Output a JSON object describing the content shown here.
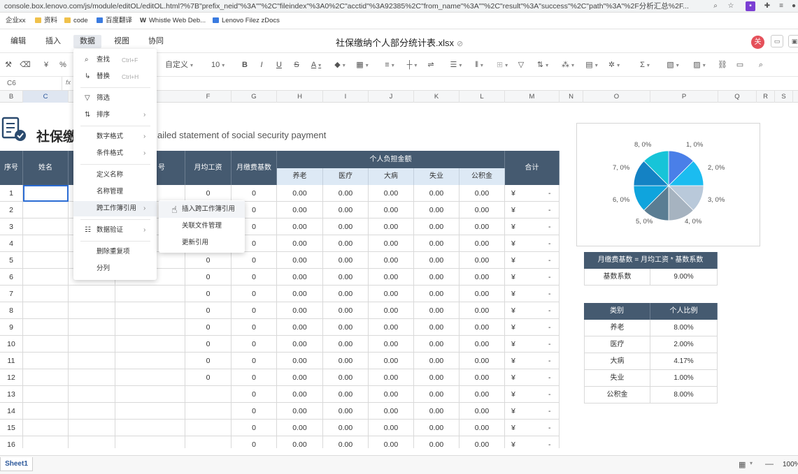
{
  "browser": {
    "url": "console.box.lenovo.com/js/module/editOL/editOL.html?%7B\"prefix_neid\"%3A\"\"%2C\"fileindex\"%3A0%2C\"acctid\"%3A92385%2C\"from_name\"%3A\"\"%2C\"result\"%3A\"success\"%2C\"path\"%3A\"%2F分析汇总%2F..."
  },
  "bookmarks": [
    "企业xx",
    "资料",
    "code",
    "百度翻译",
    "Whistle Web Deb...",
    "Lenovo Filez zDocs"
  ],
  "menubar": {
    "items": [
      "编辑",
      "插入",
      "数据",
      "视图",
      "协同"
    ],
    "active": "数据",
    "doc_title": "社保缴纳个人部分统计表.xlsx",
    "avatar": "关"
  },
  "toolbar": {
    "yen": "¥",
    "percent": "%",
    "format": "自定义",
    "fontsize": "10",
    "bold": "B",
    "italic": "I",
    "underline": "U",
    "strike": "S",
    "font_color": "A",
    "sum": "Σ"
  },
  "formula": {
    "cell": "C6",
    "fx": "fx"
  },
  "columns": [
    "B",
    "C",
    "F",
    "G",
    "H",
    "I",
    "J",
    "K",
    "L",
    "M",
    "N",
    "O",
    "P",
    "Q",
    "R",
    "S"
  ],
  "sheet": {
    "title": "社保缴",
    "subtitle": "ailed statement of social security payment",
    "headers": {
      "seq": "序号",
      "name": "姓名",
      "id_tail": "号",
      "avg_wage": "月均工资",
      "base": "月缴费基数",
      "personal": "个人负担金额",
      "total": "合计"
    },
    "subheaders": [
      "养老",
      "医疗",
      "大病",
      "失业",
      "公积金"
    ],
    "rows": [
      {
        "n": "1",
        "w": "0",
        "b": "0",
        "v": [
          "0.00",
          "0.00",
          "0.00",
          "0.00",
          "0.00"
        ],
        "cur": "¥",
        "t": "-"
      },
      {
        "n": "2",
        "w": "",
        "b": "0",
        "v": [
          "0.00",
          "0.00",
          "0.00",
          "0.00",
          "0.00"
        ],
        "cur": "¥",
        "t": "-"
      },
      {
        "n": "3",
        "w": "",
        "b": "0",
        "v": [
          "0.00",
          "0.00",
          "0.00",
          "0.00",
          "0.00"
        ],
        "cur": "¥",
        "t": "-"
      },
      {
        "n": "4",
        "w": "",
        "b": "0",
        "v": [
          "0.00",
          "0.00",
          "0.00",
          "0.00",
          "0.00"
        ],
        "cur": "¥",
        "t": "-"
      },
      {
        "n": "5",
        "w": "0",
        "b": "0",
        "v": [
          "0.00",
          "0.00",
          "0.00",
          "0.00",
          "0.00"
        ],
        "cur": "¥",
        "t": "-"
      },
      {
        "n": "6",
        "w": "0",
        "b": "0",
        "v": [
          "0.00",
          "0.00",
          "0.00",
          "0.00",
          "0.00"
        ],
        "cur": "¥",
        "t": "-"
      },
      {
        "n": "7",
        "w": "0",
        "b": "0",
        "v": [
          "0.00",
          "0.00",
          "0.00",
          "0.00",
          "0.00"
        ],
        "cur": "¥",
        "t": "-"
      },
      {
        "n": "8",
        "w": "0",
        "b": "0",
        "v": [
          "0.00",
          "0.00",
          "0.00",
          "0.00",
          "0.00"
        ],
        "cur": "¥",
        "t": "-"
      },
      {
        "n": "9",
        "w": "0",
        "b": "0",
        "v": [
          "0.00",
          "0.00",
          "0.00",
          "0.00",
          "0.00"
        ],
        "cur": "¥",
        "t": "-"
      },
      {
        "n": "10",
        "w": "0",
        "b": "0",
        "v": [
          "0.00",
          "0.00",
          "0.00",
          "0.00",
          "0.00"
        ],
        "cur": "¥",
        "t": "-"
      },
      {
        "n": "11",
        "w": "0",
        "b": "0",
        "v": [
          "0.00",
          "0.00",
          "0.00",
          "0.00",
          "0.00"
        ],
        "cur": "¥",
        "t": "-"
      },
      {
        "n": "12",
        "w": "0",
        "b": "0",
        "v": [
          "0.00",
          "0.00",
          "0.00",
          "0.00",
          "0.00"
        ],
        "cur": "¥",
        "t": "-"
      },
      {
        "n": "13",
        "w": "",
        "b": "0",
        "v": [
          "0.00",
          "0.00",
          "0.00",
          "0.00",
          "0.00"
        ],
        "cur": "¥",
        "t": "-"
      },
      {
        "n": "14",
        "w": "",
        "b": "0",
        "v": [
          "0.00",
          "0.00",
          "0.00",
          "0.00",
          "0.00"
        ],
        "cur": "¥",
        "t": "-"
      },
      {
        "n": "15",
        "w": "",
        "b": "0",
        "v": [
          "0.00",
          "0.00",
          "0.00",
          "0.00",
          "0.00"
        ],
        "cur": "¥",
        "t": "-"
      },
      {
        "n": "16",
        "w": "",
        "b": "0",
        "v": [
          "0.00",
          "0.00",
          "0.00",
          "0.00",
          "0.00"
        ],
        "cur": "¥",
        "t": "-"
      }
    ]
  },
  "pie": {
    "labels": [
      "1, 0%",
      "2, 0%",
      "3, 0%",
      "4, 0%",
      "5, 0%",
      "6, 0%",
      "7, 0%",
      "8, 0%"
    ],
    "colors": [
      "#4a7fe8",
      "#1bbcf0",
      "#b9c9da",
      "#a6b3c0",
      "#5a7d93",
      "#0fa4dd",
      "#1482c4",
      "#17c4d8"
    ]
  },
  "formula_table": {
    "header": "月缴费基数 = 月均工资 * 基数系数",
    "label": "基数系数",
    "value": "9.00%"
  },
  "ratio_table": {
    "headers": [
      "类别",
      "个人比例"
    ],
    "rows": [
      [
        "养老",
        "8.00%"
      ],
      [
        "医疗",
        "2.00%"
      ],
      [
        "大病",
        "4.17%"
      ],
      [
        "失业",
        "1.00%"
      ],
      [
        "公积金",
        "8.00%"
      ]
    ]
  },
  "data_menu": {
    "items": [
      {
        "icon": "⌕",
        "label": "查找",
        "shortcut": "Ctrl+F"
      },
      {
        "icon": "↳",
        "label": "替换",
        "shortcut": "Ctrl+H"
      },
      {
        "icon": "▽",
        "label": "筛选"
      },
      {
        "icon": "⇅",
        "label": "排序",
        "arrow": "›"
      },
      {
        "label": "数字格式",
        "arrow": "›"
      },
      {
        "label": "条件格式",
        "arrow": "›"
      },
      {
        "label": "定义名称"
      },
      {
        "label": "名称管理"
      },
      {
        "label": "跨工作簿引用",
        "arrow": "›"
      },
      {
        "icon": "☷",
        "label": "数据验证",
        "arrow": "›"
      },
      {
        "label": "删除重复项"
      },
      {
        "label": "分列"
      }
    ],
    "submenu": [
      "插入跨工作簿引用",
      "关联文件管理",
      "更新引用"
    ]
  },
  "bottom": {
    "tab": "Sheet1",
    "zoom": "100%"
  }
}
